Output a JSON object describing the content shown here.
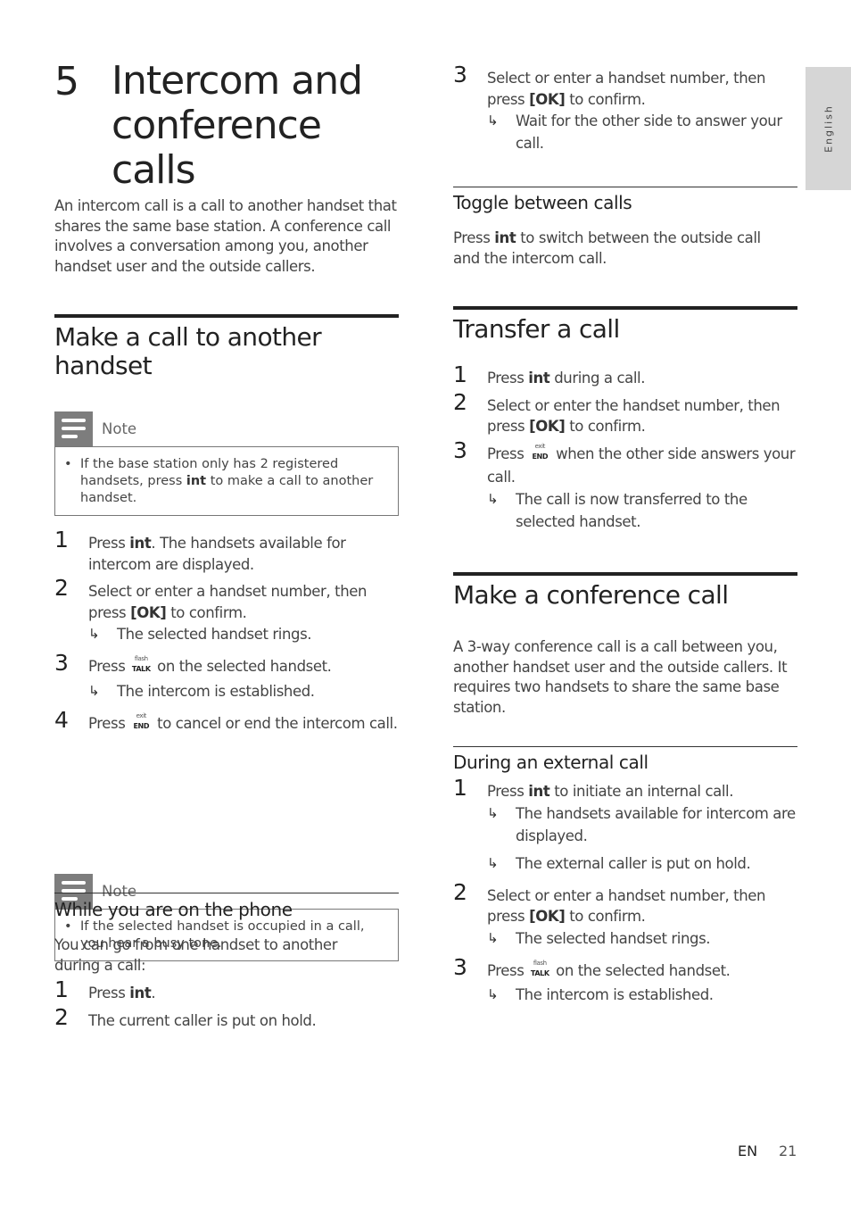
{
  "chapter": {
    "number": "5",
    "title": "Intercom and conference calls",
    "intro": "An intercom call is a call to another handset that shares the same base station. A conference call involves a conversation among you, another handset user and the outside callers."
  },
  "side_tab": {
    "language": "English"
  },
  "sections": {
    "make_call": {
      "title": "Make a call to another handset",
      "note1": {
        "label": "Note",
        "text_before": "If the base station only has 2 registered handsets, press ",
        "key": "int",
        "text_after": " to make a call to another handset."
      },
      "steps": [
        {
          "num": "1",
          "before": "Press ",
          "key": "int",
          "after": ". The handsets available for intercom are displayed."
        },
        {
          "num": "2",
          "before": "Select or enter a handset number, then press ",
          "key": "[OK]",
          "after": " to confirm.",
          "result": "The selected handset rings."
        },
        {
          "num": "3",
          "before": "Press ",
          "button": {
            "sup": "flash",
            "label": "TALK"
          },
          "after": " on the selected handset.",
          "result": "The intercom is established."
        },
        {
          "num": "4",
          "before": "Press ",
          "button": {
            "sup": "exit",
            "label": "END"
          },
          "after": " to cancel or end the intercom call."
        }
      ],
      "note2": {
        "label": "Note",
        "text": "If the selected handset is occupied in a call, you hear a busy tone."
      }
    },
    "while_on_phone": {
      "title": "While you are on the phone",
      "intro": "You can go from one handset to another during a call:",
      "steps": [
        {
          "num": "1",
          "before": "Press ",
          "key": "int",
          "after": "."
        },
        {
          "num": "2",
          "text": "The current caller is put on hold."
        }
      ]
    },
    "continued": {
      "step3": {
        "num": "3",
        "before": "Select or enter a handset number, then press ",
        "key": "[OK]",
        "after": " to confirm.",
        "result": "Wait for the other side to answer your call."
      }
    },
    "toggle": {
      "title": "Toggle between calls",
      "before": "Press ",
      "key": "int",
      "after": " to switch between the outside call and the intercom call."
    },
    "transfer": {
      "title": "Transfer a call",
      "steps": [
        {
          "num": "1",
          "before": "Press ",
          "key": "int",
          "after": " during a call."
        },
        {
          "num": "2",
          "before": "Select or enter the handset number, then press ",
          "key": "[OK]",
          "after": " to confirm."
        },
        {
          "num": "3",
          "before": "Press ",
          "button": {
            "sup": "exit",
            "label": "END"
          },
          "after": " when the other side answers your call.",
          "result": "The call is now transferred to the selected handset."
        }
      ]
    },
    "conference": {
      "title": "Make a conference call",
      "intro": "A 3-way conference call is a call between you, another handset user and the outside callers. It requires two handsets to share the same base station.",
      "subsection_title": "During an external call",
      "steps": [
        {
          "num": "1",
          "before": "Press ",
          "key": "int",
          "after": " to initiate an internal call.",
          "results": [
            "The handsets available for intercom are displayed.",
            "The external caller is put on hold."
          ]
        },
        {
          "num": "2",
          "before": "Select or enter a handset number, then press ",
          "key": "[OK]",
          "after": " to confirm.",
          "result": "The selected handset rings."
        },
        {
          "num": "3",
          "before": "Press ",
          "button": {
            "sup": "flash",
            "label": "TALK"
          },
          "after": " on the selected handset.",
          "result": "The intercom is established."
        }
      ]
    }
  },
  "footer": {
    "language_code": "EN",
    "page_number": "21"
  }
}
